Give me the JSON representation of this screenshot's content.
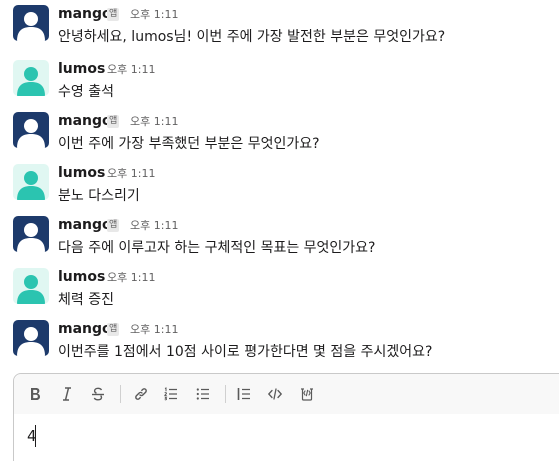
{
  "messages": [
    {
      "sender": "mango",
      "is_app": true,
      "app_badge": "앱",
      "time": "오후 1:11",
      "text": "안녕하세요, lumos님! 이번 주에 가장 발전한 부분은 무엇인가요?"
    },
    {
      "sender": "lumos",
      "is_app": false,
      "app_badge": "",
      "time": "오후 1:11",
      "text": "수영 출석"
    },
    {
      "sender": "mango",
      "is_app": true,
      "app_badge": "앱",
      "time": "오후 1:11",
      "text": "이번 주에 가장 부족했던 부분은 무엇인가요?"
    },
    {
      "sender": "lumos",
      "is_app": false,
      "app_badge": "",
      "time": "오후 1:11",
      "text": "분노 다스리기"
    },
    {
      "sender": "mango",
      "is_app": true,
      "app_badge": "앱",
      "time": "오후 1:11",
      "text": "다음 주에 이루고자 하는 구체적인 목표는 무엇인가요?"
    },
    {
      "sender": "lumos",
      "is_app": false,
      "app_badge": "",
      "time": "오후 1:11",
      "text": "체력 증진"
    },
    {
      "sender": "mango",
      "is_app": true,
      "app_badge": "앱",
      "time": "오후 1:11",
      "text": "이번주를 1점에서 10점 사이로 평가한다면 몇 점을 주시겠어요?"
    }
  ],
  "colors": {
    "mango_avatar_bg": "#1d3a6b",
    "lumos_avatar_bg": "#e0f7f2",
    "lumos_avatar_fg": "#2bc4b0",
    "text": "#1d1c1d",
    "muted": "#616061"
  },
  "composer": {
    "value": "4",
    "toolbar": [
      {
        "name": "bold-icon",
        "glyph": "B"
      },
      {
        "name": "italic-icon",
        "glyph": "I"
      },
      {
        "name": "strikethrough-icon",
        "glyph": "S"
      },
      {
        "name": "link-icon",
        "glyph": "link"
      },
      {
        "name": "ordered-list-icon",
        "glyph": "ol"
      },
      {
        "name": "bulleted-list-icon",
        "glyph": "ul"
      },
      {
        "name": "blockquote-icon",
        "glyph": "quote"
      },
      {
        "name": "code-icon",
        "glyph": "code"
      },
      {
        "name": "code-block-icon",
        "glyph": "codeblock"
      }
    ]
  }
}
